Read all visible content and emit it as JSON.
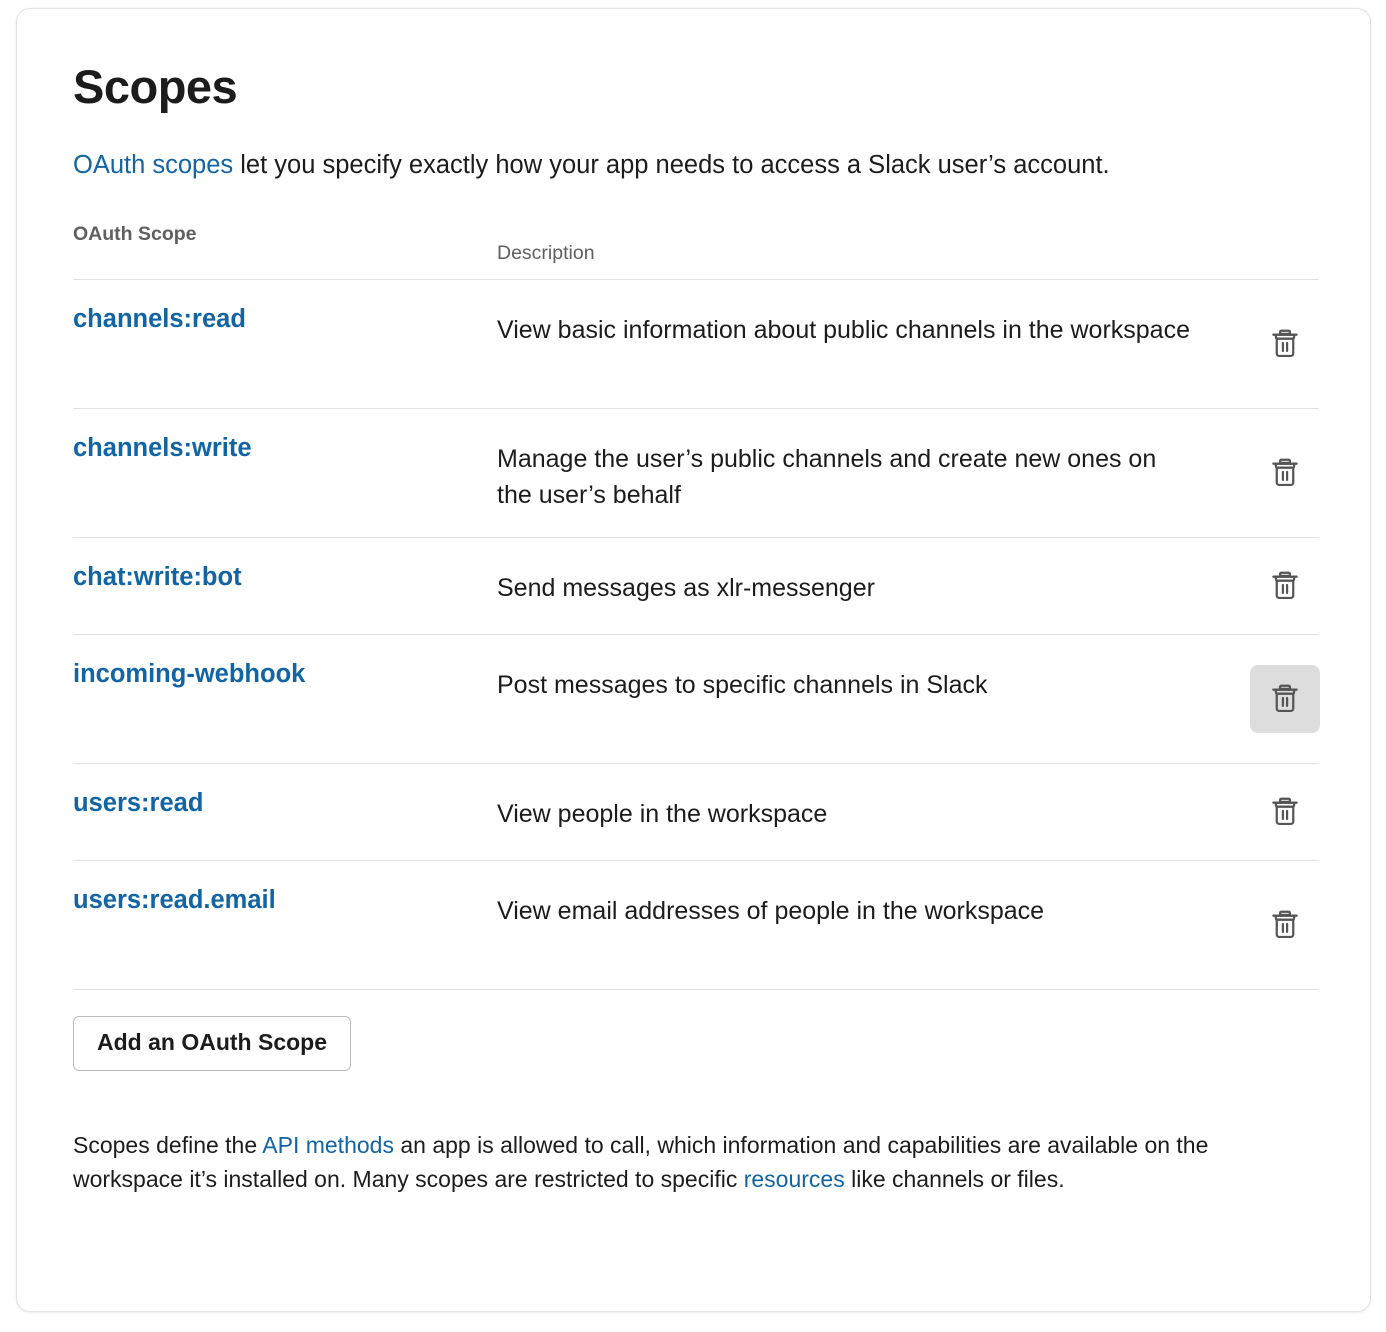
{
  "page": {
    "title": "Scopes"
  },
  "intro": {
    "link_text": "OAuth scopes",
    "rest": " let you specify exactly how your app needs to access a Slack user’s account."
  },
  "table": {
    "headers": {
      "scope": "OAuth Scope",
      "description": "Description"
    },
    "rows": [
      {
        "scope": "channels:read",
        "description": "View basic information about public channels in the workspace",
        "delete_icon": "trash-icon",
        "hovered": false
      },
      {
        "scope": "channels:write",
        "description": "Manage the user’s public channels and create new ones on the user’s behalf",
        "delete_icon": "trash-icon",
        "hovered": false
      },
      {
        "scope": "chat:write:bot",
        "description": "Send messages as xlr-messenger",
        "delete_icon": "trash-icon",
        "hovered": false
      },
      {
        "scope": "incoming-webhook",
        "description": "Post messages to specific channels in Slack",
        "delete_icon": "trash-icon",
        "hovered": true
      },
      {
        "scope": "users:read",
        "description": "View people in the workspace",
        "delete_icon": "trash-icon",
        "hovered": false
      },
      {
        "scope": "users:read.email",
        "description": "View email addresses of people in the workspace",
        "delete_icon": "trash-icon",
        "hovered": false
      }
    ]
  },
  "add_button": {
    "label": "Add an OAuth Scope"
  },
  "footnote": {
    "part1": "Scopes define the ",
    "link1": "API methods",
    "part2": " an app is allowed to call, which information and capabilities are available on the workspace it’s installed on. Many scopes are restricted to specific ",
    "link2": "resources",
    "part3": " like channels or files."
  },
  "colors": {
    "link_blue": "#1264a3",
    "text": "#1d1c1d",
    "muted": "#616061",
    "divider": "#e2e2e2",
    "hover_bg": "#dddddd",
    "icon": "#555555"
  }
}
